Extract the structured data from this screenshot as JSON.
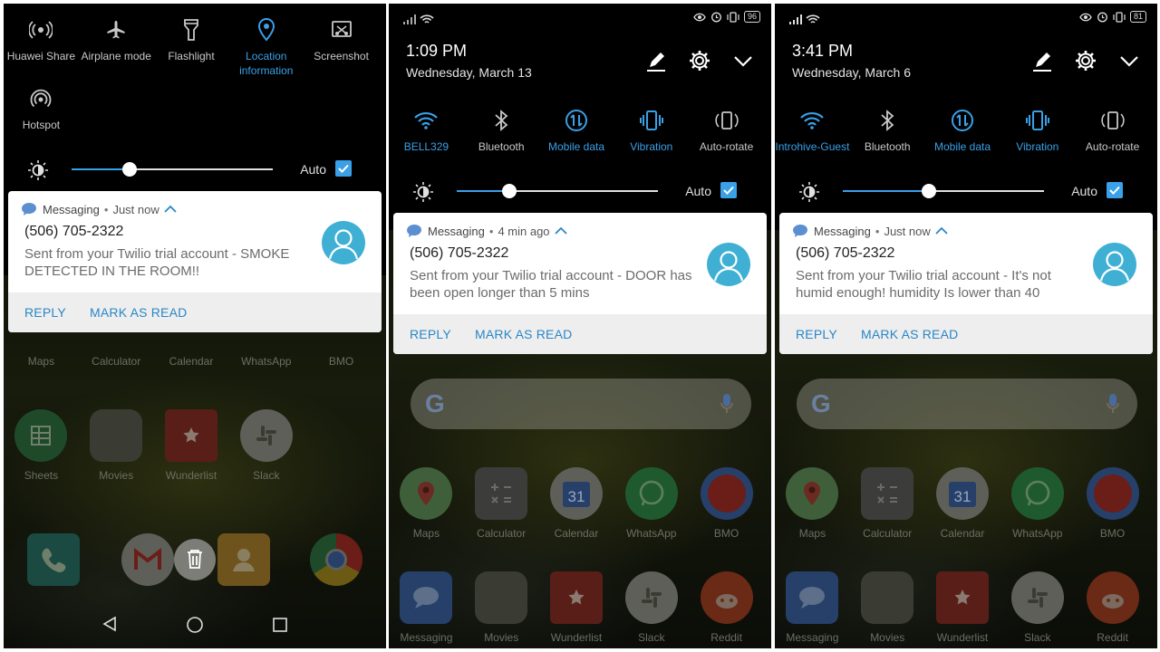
{
  "panels": [
    {
      "toggles": [
        {
          "icon": "huawei-share-icon",
          "label": "Huawei Share",
          "active": false
        },
        {
          "icon": "airplane-icon",
          "label": "Airplane mode",
          "active": false
        },
        {
          "icon": "flashlight-icon",
          "label": "Flashlight",
          "active": false
        },
        {
          "icon": "location-icon",
          "label": "Location information",
          "active": true
        },
        {
          "icon": "screenshot-icon",
          "label": "Screenshot",
          "active": false
        }
      ],
      "toggles_row2": [
        {
          "icon": "hotspot-icon",
          "label": "Hotspot",
          "active": false
        }
      ],
      "brightness": {
        "level": 0.29,
        "auto_label": "Auto",
        "auto_checked": true
      },
      "notification": {
        "app": "Messaging",
        "time": "Just now",
        "sender": "(506) 705-2322",
        "body": "Sent from your Twilio trial account - SMOKE DETECTED IN THE ROOM!!",
        "reply_label": "REPLY",
        "mark_read_label": "MARK AS READ"
      },
      "apps_row1": [
        "Maps",
        "Calculator",
        "Calendar",
        "WhatsApp",
        "BMO"
      ],
      "apps_row2": [
        "Sheets",
        "Movies",
        "Wunderlist",
        "Slack"
      ]
    },
    {
      "battery": "96",
      "time": "1:09 PM",
      "date": "Wednesday, March 13",
      "toggles": [
        {
          "icon": "wifi-icon",
          "label": "BELL329",
          "active": true
        },
        {
          "icon": "bluetooth-icon",
          "label": "Bluetooth",
          "active": false
        },
        {
          "icon": "mobile-data-icon",
          "label": "Mobile data",
          "active": true
        },
        {
          "icon": "vibration-icon",
          "label": "Vibration",
          "active": true
        },
        {
          "icon": "auto-rotate-icon",
          "label": "Auto-rotate",
          "active": false
        }
      ],
      "brightness": {
        "level": 0.26,
        "auto_label": "Auto",
        "auto_checked": true
      },
      "notification": {
        "app": "Messaging",
        "time": "4 min ago",
        "sender": "(506) 705-2322",
        "body": "Sent from your Twilio trial account - DOOR has been open longer than 5 mins",
        "reply_label": "REPLY",
        "mark_read_label": "MARK AS READ"
      },
      "apps_row1": [
        "Maps",
        "Calculator",
        "Calendar",
        "WhatsApp",
        "BMO"
      ],
      "apps_row2": [
        "Messaging",
        "Movies",
        "Wunderlist",
        "Slack",
        "Reddit"
      ]
    },
    {
      "battery": "81",
      "time": "3:41 PM",
      "date": "Wednesday, March 6",
      "toggles": [
        {
          "icon": "wifi-icon",
          "label": "Introhive-Guest",
          "active": true
        },
        {
          "icon": "bluetooth-icon",
          "label": "Bluetooth",
          "active": false
        },
        {
          "icon": "mobile-data-icon",
          "label": "Mobile data",
          "active": true
        },
        {
          "icon": "vibration-icon",
          "label": "Vibration",
          "active": true
        },
        {
          "icon": "auto-rotate-icon",
          "label": "Auto-rotate",
          "active": false
        }
      ],
      "brightness": {
        "level": 0.43,
        "auto_label": "Auto",
        "auto_checked": true
      },
      "notification": {
        "app": "Messaging",
        "time": "Just now",
        "sender": "(506) 705-2322",
        "body": "Sent from your Twilio trial account - It's not humid enough! humidity Is lower than 40",
        "reply_label": "REPLY",
        "mark_read_label": "MARK AS READ"
      },
      "apps_row1": [
        "Maps",
        "Calculator",
        "Calendar",
        "WhatsApp",
        "BMO"
      ],
      "apps_row2": [
        "Messaging",
        "Movies",
        "Wunderlist",
        "Slack",
        "Reddit"
      ]
    }
  ],
  "colors": {
    "accent": "#3aa0e8",
    "action_text": "#2a86c7",
    "avatar": "#3fb0d4"
  }
}
